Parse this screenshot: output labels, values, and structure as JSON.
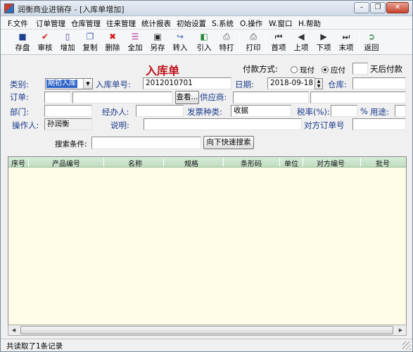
{
  "window": {
    "title": "润衡商业进销存 - [入库单增加]",
    "controls": {
      "minimize": "–",
      "restore": "❐",
      "close": "✕"
    }
  },
  "menu": [
    "F.文件",
    "订单管理",
    "仓库管理",
    "往来管理",
    "统计报表",
    "初始设置",
    "S.系统",
    "O.操作",
    "W.窗口",
    "H.帮助"
  ],
  "toolbar": {
    "save": "存盘",
    "review": "审核",
    "add": "增加",
    "copy": "复制",
    "delete": "删除",
    "add_all": "全加",
    "save_as": "另存",
    "import": "转入",
    "import_in": "引入",
    "special_print": "特打",
    "print": "打印",
    "first": "首项",
    "prev": "上项",
    "next": "下项",
    "last": "末项",
    "back": "返回"
  },
  "form": {
    "title": "入库单",
    "payment_label": "付款方式:",
    "payment_cash": "现付",
    "payment_due": "应付",
    "days_label": "天后付款",
    "category_label": "类别:",
    "category_value": "期初入库",
    "order_no_label": "入库单号:",
    "order_no_value": "2012010701",
    "date_label": "日期:",
    "date_value": "2018-09-18",
    "warehouse_label": "仓库:",
    "order_label": "订单:",
    "view_button": "查看...",
    "supplier_label": "供应商:",
    "department_label": "部门:",
    "handler_label": "经办人:",
    "invoice_label": "发票种类:",
    "invoice_value": "收据",
    "tax_label": "税率(%):",
    "percent_sign": "%",
    "usage_label": "用途:",
    "operator_label": "操作人:",
    "operator_value": "孙润衡",
    "remark_label": "说明:",
    "counter_order_label": "对方订单号",
    "search_label": "搜索条件:",
    "search_button": "向下快速搜索"
  },
  "grid": {
    "columns": [
      "序号",
      "产品编号",
      "名称",
      "规格",
      "条形码",
      "单位",
      "对方编号",
      "批号"
    ]
  },
  "status": {
    "text": "共读取了1条记录"
  }
}
